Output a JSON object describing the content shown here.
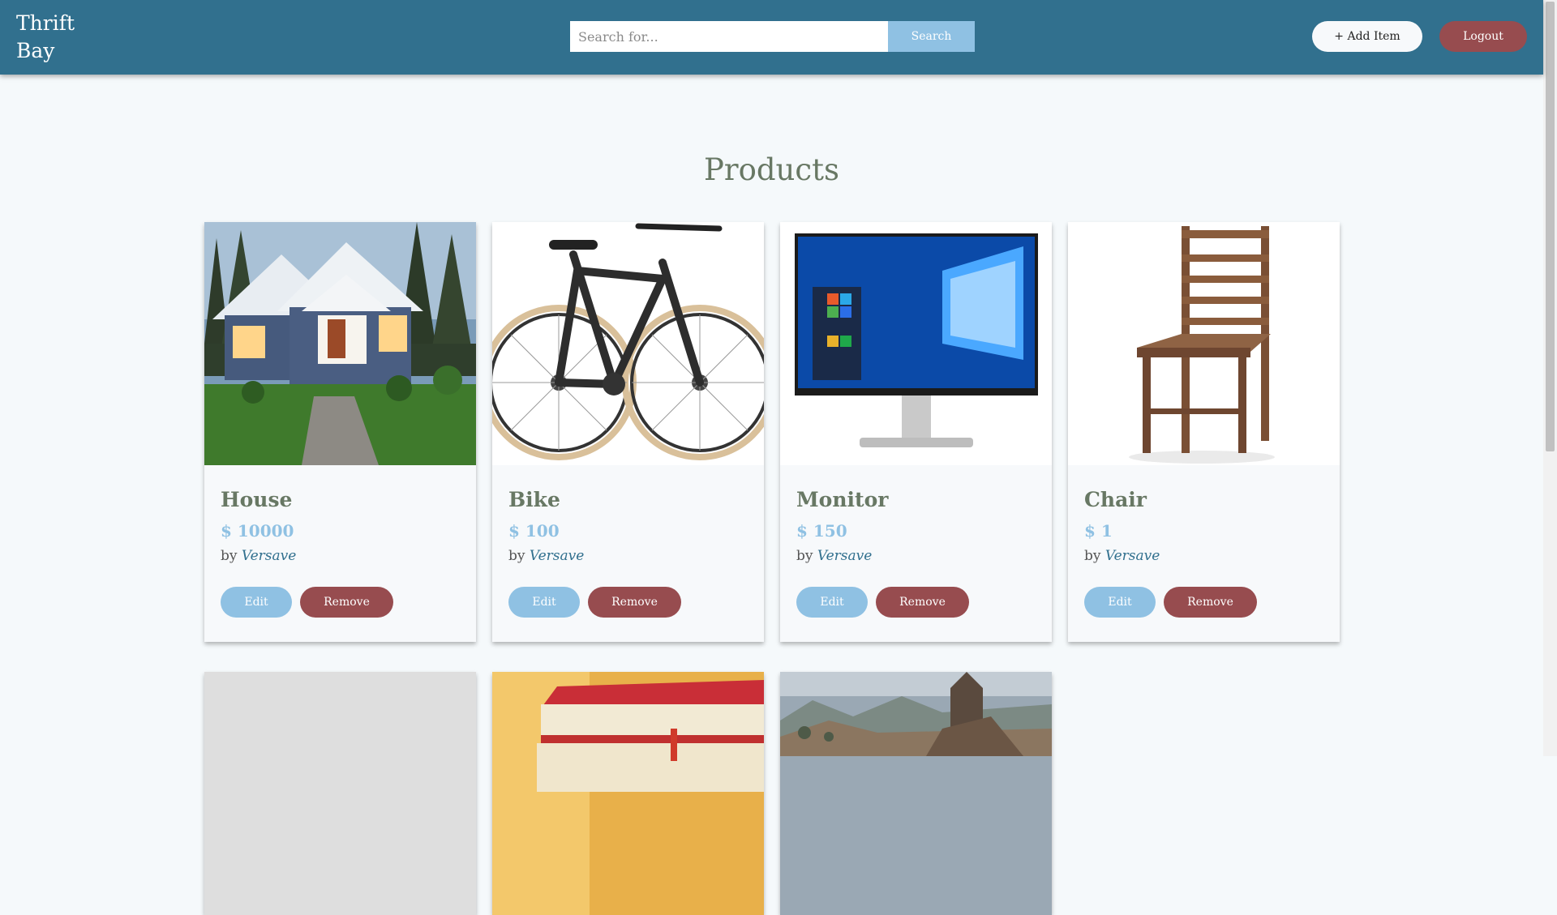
{
  "navbar": {
    "brand": "Thrift Bay",
    "search_placeholder": "Search for...",
    "search_label": "Search",
    "add_item_label": "+ Add Item",
    "logout_label": "Logout"
  },
  "main": {
    "title": "Products",
    "products": [
      {
        "name": "House",
        "price": "$ 10000",
        "by_prefix": "by",
        "seller": "Versave",
        "edit_label": "Edit",
        "remove_label": "Remove"
      },
      {
        "name": "Bike",
        "price": "$ 100",
        "by_prefix": "by",
        "seller": "Versave",
        "edit_label": "Edit",
        "remove_label": "Remove"
      },
      {
        "name": "Monitor",
        "price": "$ 150",
        "by_prefix": "by",
        "seller": "Versave",
        "edit_label": "Edit",
        "remove_label": "Remove"
      },
      {
        "name": "Chair",
        "price": "$ 1",
        "by_prefix": "by",
        "seller": "Versave",
        "edit_label": "Edit",
        "remove_label": "Remove"
      }
    ]
  },
  "colors": {
    "navbar": "#31708e",
    "accent_light": "#8fc1e3",
    "danger": "#974c4f",
    "heading": "#687864",
    "background": "#f5f9fb"
  },
  "images": [
    "house-photo",
    "bike-photo",
    "monitor-photo",
    "chair-photo",
    "placeholder-image",
    "books-photo",
    "castle-landscape-photo"
  ]
}
